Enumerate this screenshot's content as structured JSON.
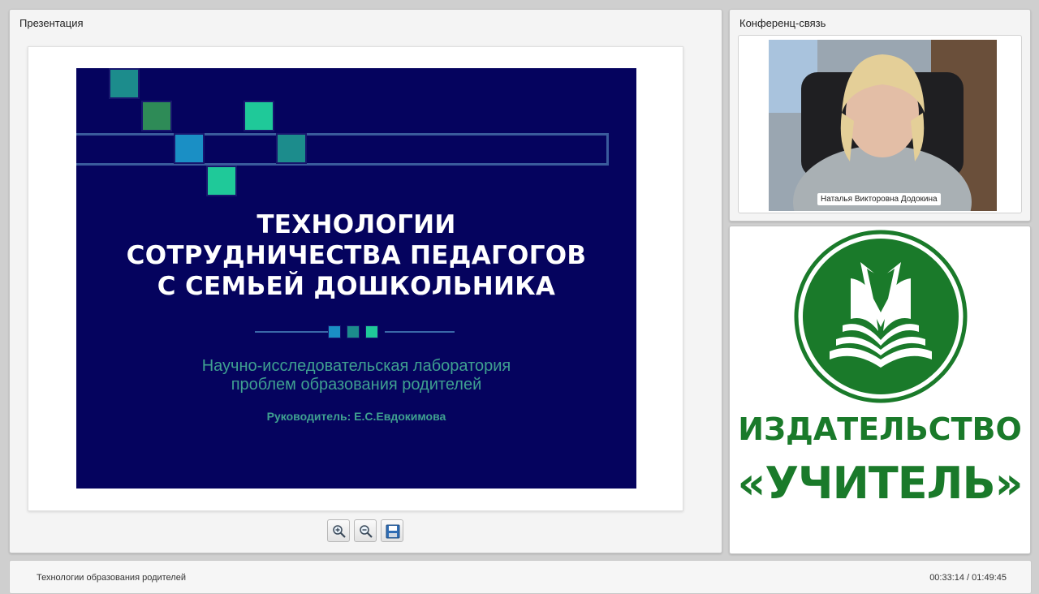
{
  "presentation": {
    "panel_title": "Презентация",
    "slide": {
      "title_lines": [
        "ТЕХНОЛОГИИ",
        "СОТРУДНИЧЕСТВА ПЕДАГОГОВ",
        "С СЕМЬЕЙ ДОШКОЛЬНИКА"
      ],
      "subtitle_lines": [
        "Научно-исследовательская лаборатория",
        "проблем образования родителей"
      ],
      "leader": "Руководитель: Е.С.Евдокимова",
      "background_color": "#05035e",
      "text_color": "#ffffff",
      "accent_color": "#3fa090"
    },
    "toolbar": {
      "zoom_in_icon": "zoom-in-icon",
      "zoom_out_icon": "zoom-out-icon",
      "save_icon": "floppy-disk-icon"
    }
  },
  "conference": {
    "panel_title": "Конференц-связь",
    "speaker_name": "Наталья Викторовна Додокина"
  },
  "logo": {
    "line1": "ИЗДАТЕЛЬСТВО",
    "line2": "«УЧИТЕЛЬ»",
    "brand_color": "#1a7a2a"
  },
  "bottom_bar": {
    "title": "Технологии образования родителей",
    "time": "00:33:14 / 01:49:45"
  }
}
